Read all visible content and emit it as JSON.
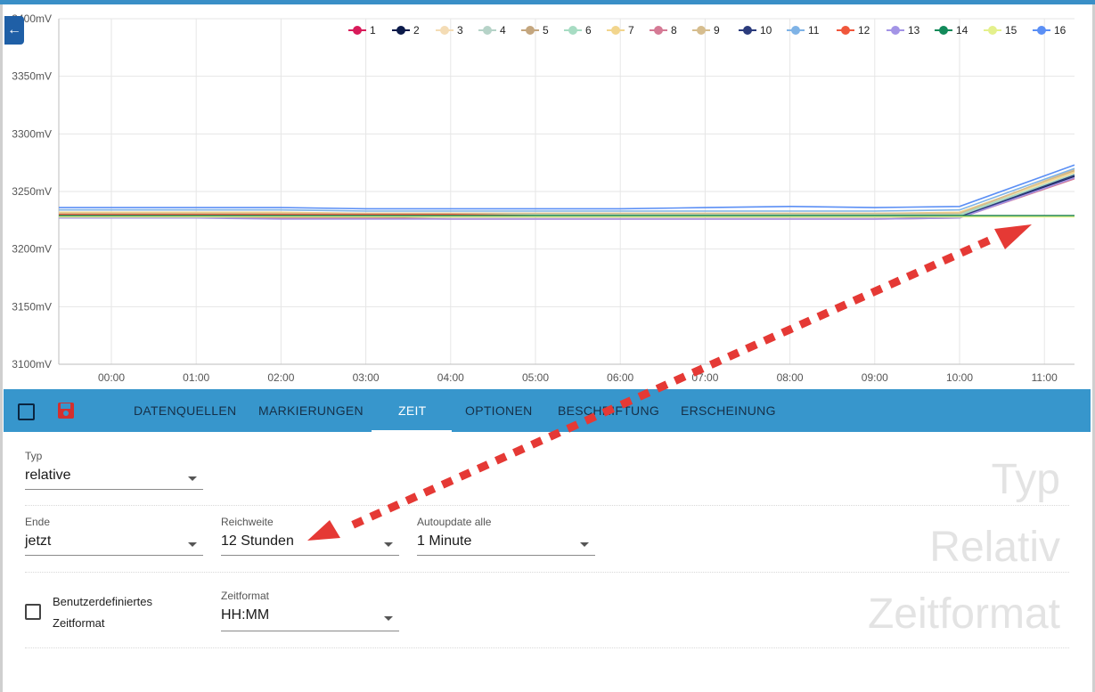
{
  "chart_data": {
    "type": "line",
    "y_unit": "mV",
    "y_ticks": [
      "3400mV",
      "3350mV",
      "3300mV",
      "3250mV",
      "3200mV",
      "3150mV",
      "3100mV"
    ],
    "ylim": [
      3100,
      3400
    ],
    "x_ticks": [
      "00:00",
      "01:00",
      "02:00",
      "03:00",
      "04:00",
      "05:00",
      "06:00",
      "07:00",
      "08:00",
      "09:00",
      "10:00",
      "11:00"
    ],
    "grid": true,
    "legend_position": "top-right",
    "series": [
      {
        "name": "1",
        "color": "#d81b5a",
        "values": [
          3229,
          3229,
          3228,
          3228,
          3228,
          3228,
          3228,
          3228,
          3228,
          3228,
          3228,
          3262
        ]
      },
      {
        "name": "2",
        "color": "#0b1a4a",
        "values": [
          3228,
          3228,
          3228,
          3228,
          3228,
          3228,
          3228,
          3228,
          3228,
          3228,
          3228,
          3263
        ]
      },
      {
        "name": "3",
        "color": "#f4dcb5",
        "values": [
          3230,
          3230,
          3229,
          3229,
          3229,
          3229,
          3229,
          3229,
          3229,
          3229,
          3230,
          3266
        ]
      },
      {
        "name": "4",
        "color": "#b6d3c8",
        "values": [
          3229,
          3229,
          3229,
          3229,
          3229,
          3229,
          3229,
          3229,
          3229,
          3229,
          3229,
          3264
        ]
      },
      {
        "name": "5",
        "color": "#c4a67e",
        "values": [
          3231,
          3231,
          3230,
          3230,
          3230,
          3230,
          3230,
          3230,
          3230,
          3230,
          3231,
          3268
        ]
      },
      {
        "name": "6",
        "color": "#a7dcc3",
        "values": [
          3230,
          3230,
          3230,
          3230,
          3230,
          3230,
          3230,
          3230,
          3230,
          3230,
          3230,
          3265
        ]
      },
      {
        "name": "7",
        "color": "#f2d58d",
        "values": [
          3232,
          3232,
          3232,
          3231,
          3231,
          3231,
          3231,
          3231,
          3231,
          3231,
          3232,
          3267
        ]
      },
      {
        "name": "8",
        "color": "#d57a95",
        "values": [
          3227,
          3227,
          3227,
          3227,
          3226,
          3226,
          3226,
          3226,
          3226,
          3226,
          3227,
          3261
        ]
      },
      {
        "name": "9",
        "color": "#d6bd8e",
        "values": [
          3231,
          3231,
          3231,
          3231,
          3231,
          3231,
          3231,
          3231,
          3231,
          3231,
          3231,
          3269
        ]
      },
      {
        "name": "10",
        "color": "#2b3b7c",
        "values": [
          3228,
          3228,
          3228,
          3228,
          3228,
          3228,
          3228,
          3228,
          3228,
          3228,
          3228,
          3264
        ]
      },
      {
        "name": "11",
        "color": "#7fb3e6",
        "values": [
          3234,
          3234,
          3234,
          3233,
          3233,
          3233,
          3233,
          3233,
          3233,
          3233,
          3234,
          3270
        ]
      },
      {
        "name": "12",
        "color": "#f0573c",
        "values": [
          3230,
          3230,
          3230,
          3230,
          3230,
          3229,
          3229,
          3229,
          3229,
          3229,
          3229,
          3229
        ]
      },
      {
        "name": "13",
        "color": "#a394e6",
        "values": [
          3227,
          3227,
          3226,
          3226,
          3226,
          3226,
          3226,
          3226,
          3226,
          3226,
          3227,
          3262
        ]
      },
      {
        "name": "14",
        "color": "#128a5a",
        "values": [
          3229,
          3229,
          3229,
          3229,
          3229,
          3229,
          3229,
          3229,
          3229,
          3229,
          3229,
          3229
        ]
      },
      {
        "name": "15",
        "color": "#e4f08c",
        "values": [
          3228,
          3228,
          3228,
          3228,
          3228,
          3228,
          3228,
          3228,
          3228,
          3228,
          3228,
          3228
        ]
      },
      {
        "name": "16",
        "color": "#5b8ff5",
        "values": [
          3236,
          3236,
          3236,
          3235,
          3235,
          3235,
          3235,
          3236,
          3237,
          3236,
          3237,
          3273
        ]
      }
    ]
  },
  "toolbar": {
    "tabs": [
      "DATENQUELLEN",
      "MARKIERUNGEN",
      "ZEIT",
      "OPTIONEN",
      "BESCHRIFTUNG",
      "ERSCHEINUNG"
    ],
    "active_tab": "ZEIT",
    "save_color": "#d32f2f"
  },
  "form": {
    "typ": {
      "label": "Typ",
      "value": "relative"
    },
    "ende": {
      "label": "Ende",
      "value": "jetzt"
    },
    "reichweite": {
      "label": "Reichweite",
      "value": "12 Stunden"
    },
    "autoupdate": {
      "label": "Autoupdate alle",
      "value": "1 Minute"
    },
    "custom_format": {
      "label_line1": "Benutzerdefiniertes",
      "label_line2": "Zeitformat",
      "checked": false
    },
    "zeitformat": {
      "label": "Zeitformat",
      "value": "HH:MM"
    },
    "section_titles": [
      "Typ",
      "Relativ",
      "Zeitformat"
    ]
  },
  "icons": {
    "back": "arrow-left-icon",
    "save": "floppy-disk-icon"
  }
}
